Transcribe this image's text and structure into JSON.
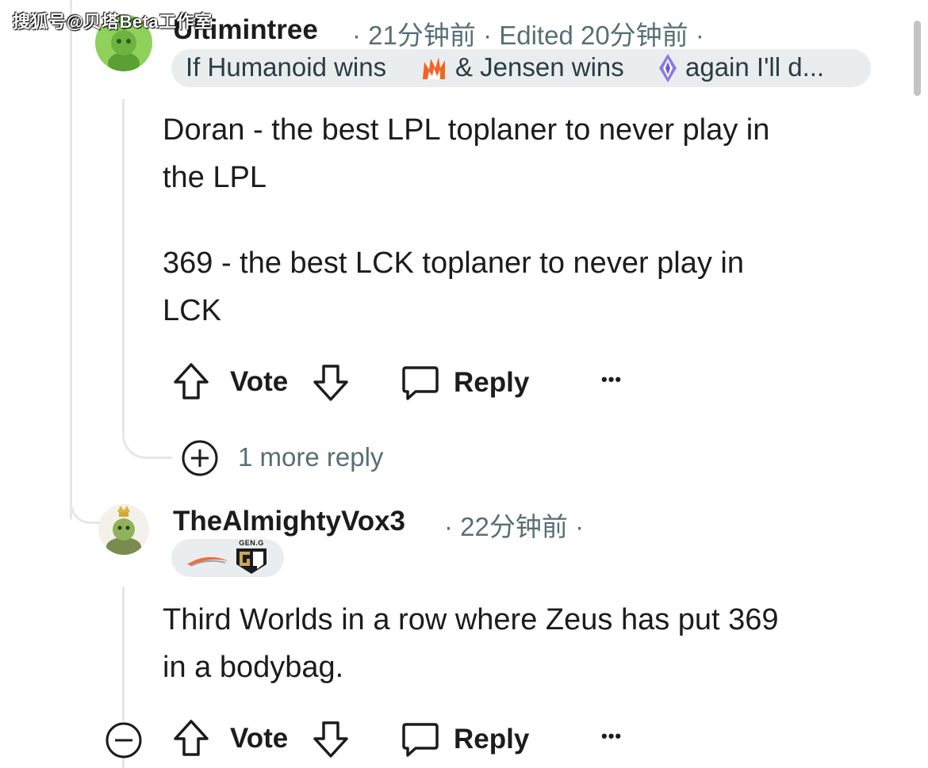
{
  "watermark": "搜狐号@贝塔Beta工作室",
  "comments": [
    {
      "username": "Ultimintree",
      "time": "21分钟前",
      "edited": "Edited 20分钟前",
      "flair": {
        "part1": "If Humanoid wins",
        "part2": "& Jensen wins",
        "part3": "again I'll d..."
      },
      "body": [
        "Doran - the best LPL toplaner to never play in",
        "the LPL",
        "369 - the best LCK toplaner to never play in",
        "LCK"
      ],
      "actions": {
        "vote": "Vote",
        "reply": "Reply",
        "more": "•••"
      },
      "more_replies": "1 more reply"
    },
    {
      "username": "TheAlmightyVox3",
      "time": "22分钟前",
      "flair_logo_text": "GEN.G",
      "body": [
        "Third Worlds in a row where Zeus has put 369",
        "in a bodybag."
      ],
      "actions": {
        "vote": "Vote",
        "reply": "Reply",
        "more": "•••"
      }
    }
  ],
  "colors": {
    "meta": "#576f76",
    "flair_bg": "#eaedef",
    "thread_line": "#e5e7ea",
    "avatar1": "#8fd15a"
  }
}
